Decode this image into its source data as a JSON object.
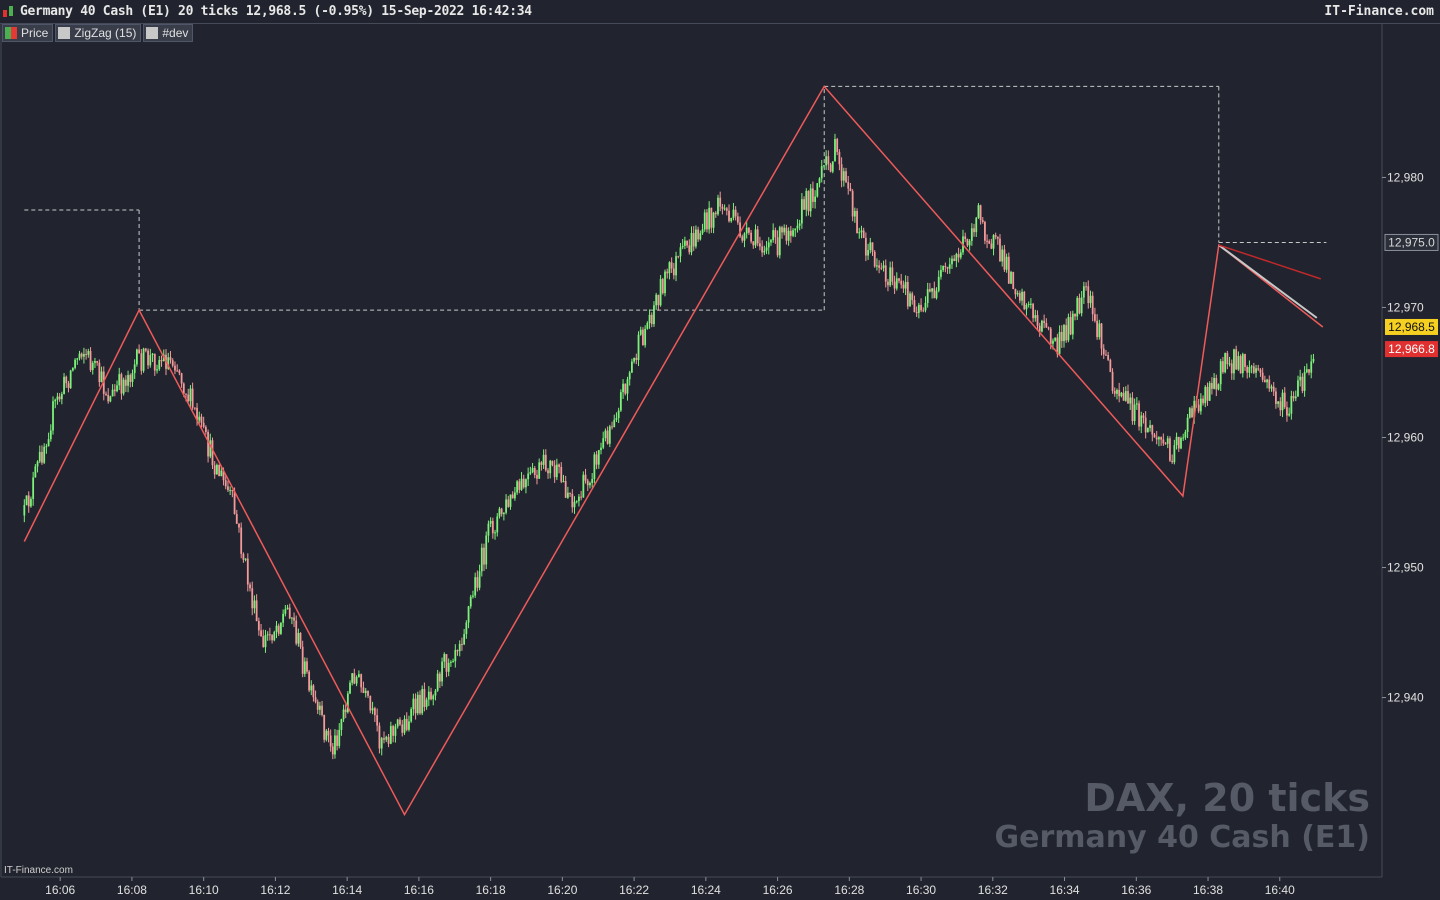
{
  "header": {
    "title": "Germany 40 Cash (E1) 20 ticks 12,968.5 (-0.95%) 15-Sep-2022 16:42:34",
    "brand": "IT-Finance.com"
  },
  "legend": [
    {
      "label": "Price",
      "color": "#4caf50"
    },
    {
      "label": "ZigZag (15)",
      "color": "#c8c8c8"
    },
    {
      "label": "#dev",
      "color": "#c8c8c8"
    }
  ],
  "watermark": {
    "line1": "DAX, 20 ticks",
    "line2": "Germany 40 Cash (E1)"
  },
  "footer_brand": "IT-Finance.com",
  "colors": {
    "background": "#21242e",
    "up": "#7cf27a",
    "down": "#f49a9a",
    "zigzag": "#ef5a5a",
    "dev": "#c8c8c8",
    "last_price": "#f5d020",
    "last_bid": "#e03030"
  },
  "chart_data": {
    "type": "line",
    "title": "Germany 40 Cash (E1) 20 ticks",
    "x_tick_labels": [
      "16:06",
      "16:08",
      "16:10",
      "16:12",
      "16:14",
      "16:16",
      "16:18",
      "16:20",
      "16:22",
      "16:24",
      "16:26",
      "16:28",
      "16:30",
      "16:32",
      "16:34",
      "16:36",
      "16:38",
      "16:40"
    ],
    "y_ticks": [
      12940,
      12950,
      12960,
      12970,
      12980
    ],
    "y_tick_labels": [
      "12,940",
      "12,950",
      "12,960",
      "12,970",
      "12,980"
    ],
    "ylim": [
      12926.2,
      12991.8
    ],
    "price_series": {
      "name": "Price",
      "x": [
        "16:05.0",
        "16:05.8",
        "16:06.6",
        "16:07.4",
        "16:08.2",
        "16:09.2",
        "16:10.0",
        "16:10.8",
        "16:11.6",
        "16:12.4",
        "16:13.0",
        "16:13.6",
        "16:14.2",
        "16:14.9",
        "16:15.6",
        "16:16.4",
        "16:17.2",
        "16:18.0",
        "16:18.8",
        "16:19.6",
        "16:20.4",
        "16:21.2",
        "16:22.0",
        "16:22.8",
        "16:23.6",
        "16:24.4",
        "16:25.2",
        "16:26.0",
        "16:26.8",
        "16:27.6",
        "16:28.4",
        "16:29.2",
        "16:30.0",
        "16:30.8",
        "16:31.6",
        "16:32.2",
        "16:33.0",
        "16:33.8",
        "16:34.6",
        "16:35.4",
        "16:36.2",
        "16:37.0",
        "16:37.8",
        "16:38.6",
        "16:39.4",
        "16:40.2",
        "16:41.0"
      ],
      "values": [
        12954,
        12962,
        12967,
        12963,
        12966,
        12966,
        12960,
        12955,
        12944,
        12947,
        12940,
        12936,
        12942,
        12937,
        12938,
        12941,
        12945,
        12953,
        12956,
        12958,
        12955,
        12960,
        12966,
        12972,
        12975,
        12978,
        12975,
        12975,
        12978,
        12982,
        12975,
        12972,
        12970,
        12973,
        12977,
        12974,
        12970,
        12967,
        12971,
        12964,
        12961,
        12959,
        12963,
        12966,
        12965,
        12962,
        12966
      ]
    },
    "zigzag": {
      "name": "ZigZag (15)",
      "points": [
        {
          "x": "16:05.0",
          "y": 12952.0
        },
        {
          "x": "16:08.2",
          "y": 12969.8
        },
        {
          "x": "16:15.6",
          "y": 12931.0
        },
        {
          "x": "16:27.3",
          "y": 12987.0
        },
        {
          "x": "16:37.3",
          "y": 12955.5
        },
        {
          "x": "16:38.3",
          "y": 12974.8
        },
        {
          "x": "16:41.2",
          "y": 12968.5
        }
      ]
    },
    "dev": {
      "name": "#dev",
      "levels": [
        {
          "from": "16:05.0",
          "to": "16:08.2",
          "y": 12977.5
        },
        {
          "from": "16:08.2",
          "to": "16:27.3",
          "y": 12969.8
        },
        {
          "from": "16:27.3",
          "to": "16:38.3",
          "y": 12987.0
        },
        {
          "from": "16:38.3",
          "to": "16:41.3",
          "y": 12975.0
        }
      ]
    },
    "price_labels": [
      {
        "value": 12975.0,
        "text": "12,975.0",
        "kind": "level"
      },
      {
        "value": 12968.5,
        "text": "12,968.5",
        "kind": "last"
      },
      {
        "value": 12966.8,
        "text": "12,966.8",
        "kind": "bid"
      }
    ],
    "grid": false
  }
}
